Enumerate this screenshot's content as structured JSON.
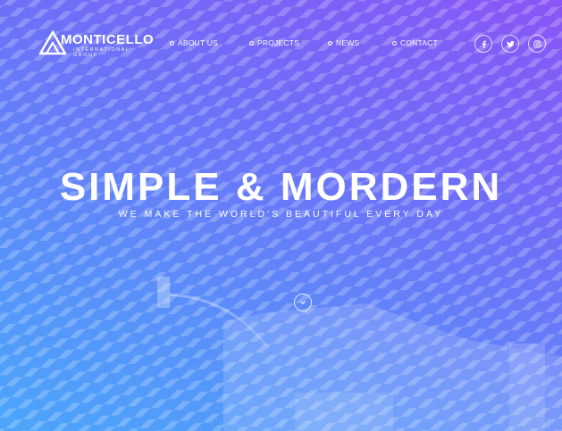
{
  "brand": {
    "name": "MONTICELLO",
    "tagline": "INTERNATIONAL GROUP"
  },
  "nav": [
    {
      "label": "ABOUT US"
    },
    {
      "label": "PROJECTS"
    },
    {
      "label": "NEWS"
    },
    {
      "label": "CONTACT"
    }
  ],
  "social": [
    {
      "icon": "facebook-icon"
    },
    {
      "icon": "twitter-icon"
    },
    {
      "icon": "instagram-icon"
    }
  ],
  "hero": {
    "title": "SIMPLE & MORDERN",
    "subtitle": "WE MAKE THE WORLD'S BEAUTIFUL EVERY DAY",
    "scroll_icon": "chevron-down-icon"
  },
  "colors": {
    "gradient_top": "#8a55f6",
    "gradient_bottom": "#4ba6fb",
    "text": "#ffffff"
  }
}
